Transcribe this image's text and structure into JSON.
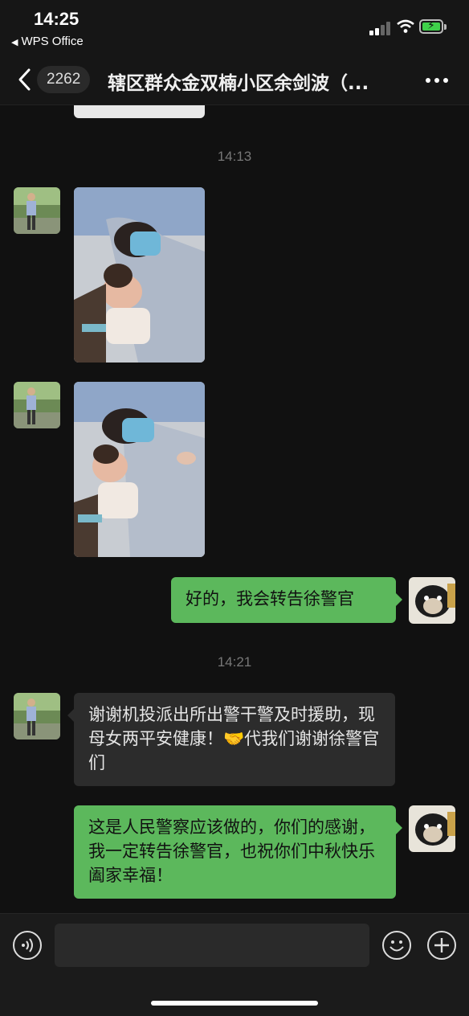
{
  "status_bar": {
    "time": "14:25",
    "back_app": "WPS Office"
  },
  "nav": {
    "unread_count": "2262",
    "title": "辖区群众金双楠小区余剑波（..."
  },
  "messages": {
    "ts1": "14:13",
    "ts2": "14:21",
    "sent1": "好的，我会转告徐警官",
    "recv1": "谢谢机投派出所出警干警及时援助，现母女两平安健康！🤝代我们谢谢徐警官们",
    "sent2": "这是人民警察应该做的，你们的感谢，我一定转告徐警官，也祝你们中秋快乐阖家幸福！"
  },
  "input": {
    "placeholder": ""
  },
  "icons": {
    "back": "chevron-left-icon",
    "more": "more-icon",
    "voice": "voice-icon",
    "emoji": "emoji-icon",
    "add": "plus-icon"
  },
  "colors": {
    "sent_bubble": "#5cb85c",
    "recv_bubble": "#2c2c2c",
    "background": "#111111"
  }
}
